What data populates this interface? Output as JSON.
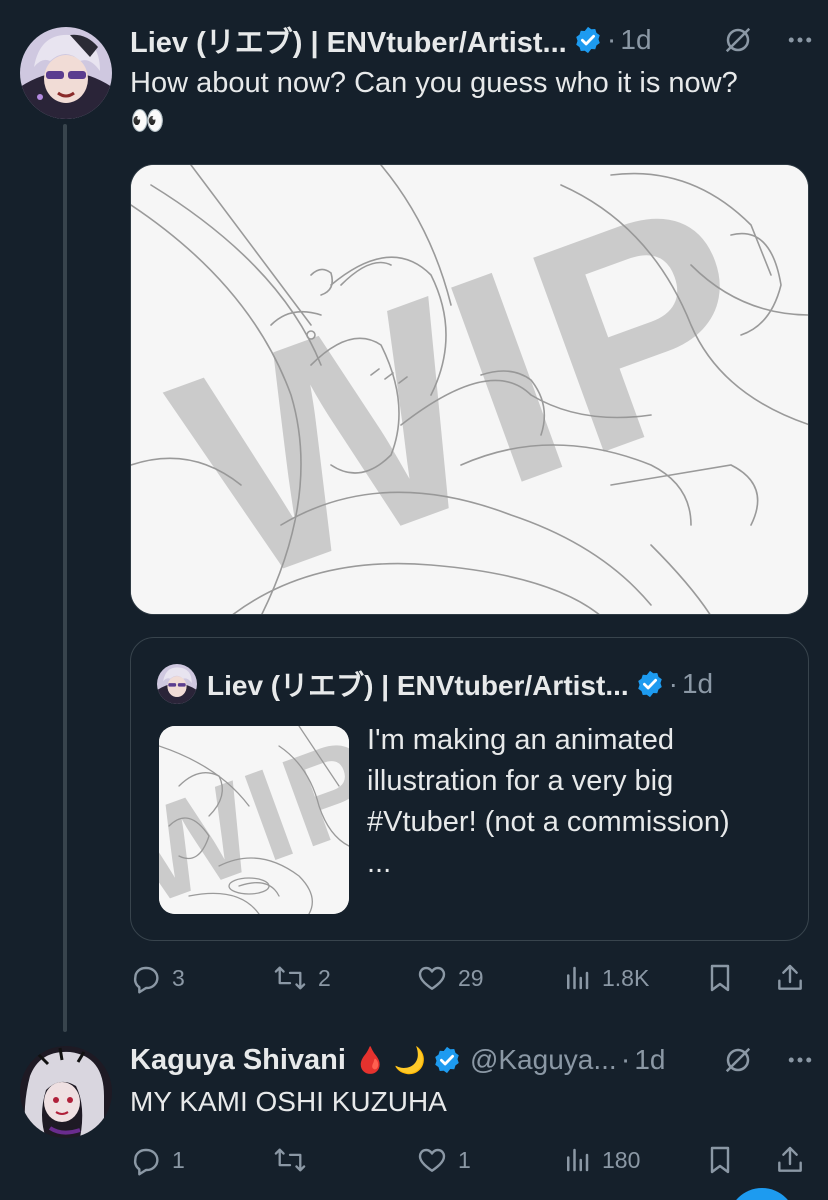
{
  "tweet1": {
    "author_name": "Liev (リエブ) | ENVtuber/Artist...",
    "time": "1d",
    "text": "How about now? Can you guess who it is now?",
    "emoji": "👀",
    "media_watermark": "WIP",
    "quote": {
      "author_name": "Liev (リエブ) | ENVtuber/Artist...",
      "time": "1d",
      "text": "I'm making an animated illustration for a very big #Vtuber! (not a commission)",
      "ellipsis": "...",
      "thumb_watermark": "WIP"
    },
    "actions": {
      "replies": "3",
      "retweets": "2",
      "likes": "29",
      "views": "1.8K"
    }
  },
  "tweet2": {
    "author_name": "Kaguya Shivani",
    "author_emojis": "🩸 🌙",
    "handle": "@Kaguya...",
    "time": "1d",
    "text": "MY KAMI OSHI KUZUHA",
    "actions": {
      "replies": "1",
      "retweets": "",
      "likes": "1",
      "views": "180"
    }
  },
  "colors": {
    "background": "#15202b",
    "text": "#e7e9ea",
    "muted": "#8b98a5",
    "accent": "#1d9bf0",
    "divider": "#38444d"
  },
  "icons": [
    "verified-icon",
    "mute-icon",
    "more-icon",
    "reply-icon",
    "retweet-icon",
    "like-icon",
    "views-icon",
    "bookmark-icon",
    "share-icon"
  ]
}
